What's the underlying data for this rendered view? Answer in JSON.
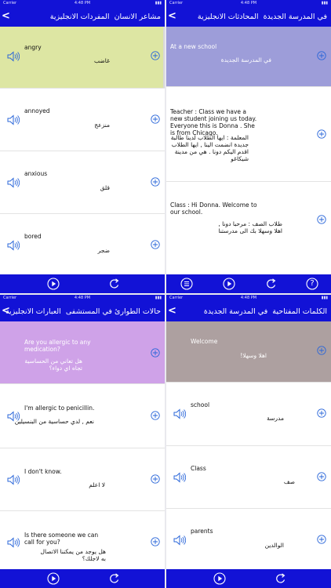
{
  "status": {
    "carrier": "Carrier",
    "time": "4:48 PM"
  },
  "panels": [
    {
      "back_glyph": "<",
      "title_main": "مشاعر الانسان",
      "title_sub": "المفردات الانجليزية",
      "rows": [
        {
          "en": "angry",
          "ar": "غاضب"
        },
        {
          "en": "annoyed",
          "ar": "منزعج"
        },
        {
          "en": "anxious",
          "ar": "قلق"
        },
        {
          "en": "bored",
          "ar": "ضجر"
        }
      ]
    },
    {
      "back_glyph": "<",
      "title_main": "في المدرسة الجديدة",
      "title_sub": "المحادثات الانجليزية",
      "rows": [
        {
          "en": "At a new school",
          "ar": "في المدرسة الجديدة"
        },
        {
          "en": "Teacher : Class we have a new student joining us today. Everyone this is Donna . She is from Chicago.",
          "ar": "المعلمة : ايها الطلاب لدينا طالبة جديدة انضمت الينا , ايها الطلاب اقدم اليكم دونا . هي من مدينة شيكاغو"
        },
        {
          "en": "Class : Hi Donna. Welcome to our school.",
          "ar": "طلاب الصف : مرحبا دونا , اهلا وسهلا بك الى مدرستنا"
        }
      ]
    },
    {
      "back_glyph": "<",
      "title_main": "حالات الطوارئ في المستشفى",
      "title_sub": "العبارات الانجليزية",
      "rows": [
        {
          "en": "Are you allergic to any medication?",
          "ar": "هل تعاني من الحساسية تجاه اي دواء؟"
        },
        {
          "en": "I'm allergic to penicillin.",
          "ar": "نعم , لدي حساسية من البنسيلين"
        },
        {
          "en": "I don't know.",
          "ar": "لا اعلم"
        },
        {
          "en": "Is there someone we can call for you?",
          "ar": "هل يوجد من يمكننا الاتصال به لاجلك؟"
        }
      ]
    },
    {
      "back_glyph": "<",
      "title_main": "الكلمات المفتاحية",
      "title_sub": "في المدرسة الجديدة",
      "rows": [
        {
          "en": "Welcome",
          "ar": "اهلا وسهلا!"
        },
        {
          "en": "school",
          "ar": "مدرسة"
        },
        {
          "en": "Class",
          "ar": "صف"
        },
        {
          "en": "parents",
          "ar": "الوالدين"
        }
      ]
    }
  ],
  "colors": {
    "bar": "#1212d6",
    "panel1_highlight": "#dde6a3",
    "panel2_highlight": "#9d9dd9",
    "panel3_highlight": "#cfa2e8",
    "panel4_highlight": "#ada0a0",
    "accent": "#2a66d9"
  },
  "icons": {
    "speaker": "speaker-icon",
    "add": "plus-circle-icon",
    "play": "play-icon",
    "repeat": "repeat-icon",
    "list": "list-icon",
    "help": "help-icon"
  },
  "toolbar_help_glyph": "?"
}
